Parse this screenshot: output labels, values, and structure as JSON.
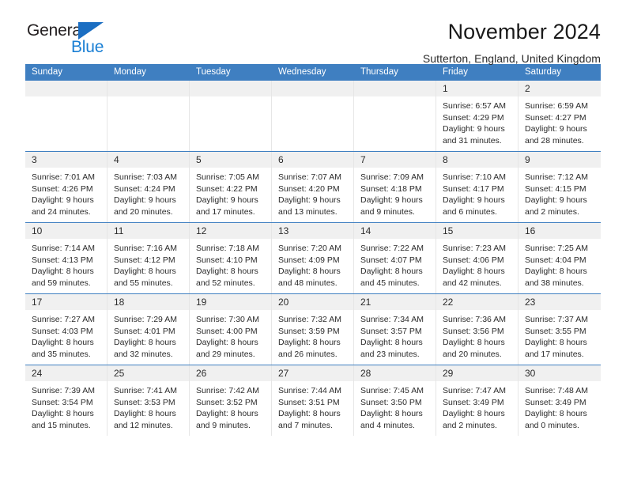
{
  "brand": {
    "name_part1": "General",
    "name_part2": "Blue",
    "triangle_icon": "triangle-icon",
    "accent_color": "#1b6ec2",
    "blue_text_color": "#1a7fd4"
  },
  "header": {
    "title": "November 2024",
    "subtitle": "Sutterton, England, United Kingdom"
  },
  "colors": {
    "header_blue": "#3f7fc1",
    "cell_head_gray": "#f0f0f0",
    "text": "#2b2b2b"
  },
  "weekdays": [
    "Sunday",
    "Monday",
    "Tuesday",
    "Wednesday",
    "Thursday",
    "Friday",
    "Saturday"
  ],
  "labels": {
    "sunrise_prefix": "Sunrise:",
    "sunset_prefix": "Sunset:",
    "daylight_prefix": "Daylight:"
  },
  "weeks": [
    [
      {
        "day": "",
        "sunrise": "",
        "sunset": "",
        "daylight": "",
        "empty": true
      },
      {
        "day": "",
        "sunrise": "",
        "sunset": "",
        "daylight": "",
        "empty": true
      },
      {
        "day": "",
        "sunrise": "",
        "sunset": "",
        "daylight": "",
        "empty": true
      },
      {
        "day": "",
        "sunrise": "",
        "sunset": "",
        "daylight": "",
        "empty": true
      },
      {
        "day": "",
        "sunrise": "",
        "sunset": "",
        "daylight": "",
        "empty": true
      },
      {
        "day": "1",
        "sunrise": "Sunrise: 6:57 AM",
        "sunset": "Sunset: 4:29 PM",
        "daylight": "Daylight: 9 hours and 31 minutes.",
        "empty": false
      },
      {
        "day": "2",
        "sunrise": "Sunrise: 6:59 AM",
        "sunset": "Sunset: 4:27 PM",
        "daylight": "Daylight: 9 hours and 28 minutes.",
        "empty": false
      }
    ],
    [
      {
        "day": "3",
        "sunrise": "Sunrise: 7:01 AM",
        "sunset": "Sunset: 4:26 PM",
        "daylight": "Daylight: 9 hours and 24 minutes.",
        "empty": false
      },
      {
        "day": "4",
        "sunrise": "Sunrise: 7:03 AM",
        "sunset": "Sunset: 4:24 PM",
        "daylight": "Daylight: 9 hours and 20 minutes.",
        "empty": false
      },
      {
        "day": "5",
        "sunrise": "Sunrise: 7:05 AM",
        "sunset": "Sunset: 4:22 PM",
        "daylight": "Daylight: 9 hours and 17 minutes.",
        "empty": false
      },
      {
        "day": "6",
        "sunrise": "Sunrise: 7:07 AM",
        "sunset": "Sunset: 4:20 PM",
        "daylight": "Daylight: 9 hours and 13 minutes.",
        "empty": false
      },
      {
        "day": "7",
        "sunrise": "Sunrise: 7:09 AM",
        "sunset": "Sunset: 4:18 PM",
        "daylight": "Daylight: 9 hours and 9 minutes.",
        "empty": false
      },
      {
        "day": "8",
        "sunrise": "Sunrise: 7:10 AM",
        "sunset": "Sunset: 4:17 PM",
        "daylight": "Daylight: 9 hours and 6 minutes.",
        "empty": false
      },
      {
        "day": "9",
        "sunrise": "Sunrise: 7:12 AM",
        "sunset": "Sunset: 4:15 PM",
        "daylight": "Daylight: 9 hours and 2 minutes.",
        "empty": false
      }
    ],
    [
      {
        "day": "10",
        "sunrise": "Sunrise: 7:14 AM",
        "sunset": "Sunset: 4:13 PM",
        "daylight": "Daylight: 8 hours and 59 minutes.",
        "empty": false
      },
      {
        "day": "11",
        "sunrise": "Sunrise: 7:16 AM",
        "sunset": "Sunset: 4:12 PM",
        "daylight": "Daylight: 8 hours and 55 minutes.",
        "empty": false
      },
      {
        "day": "12",
        "sunrise": "Sunrise: 7:18 AM",
        "sunset": "Sunset: 4:10 PM",
        "daylight": "Daylight: 8 hours and 52 minutes.",
        "empty": false
      },
      {
        "day": "13",
        "sunrise": "Sunrise: 7:20 AM",
        "sunset": "Sunset: 4:09 PM",
        "daylight": "Daylight: 8 hours and 48 minutes.",
        "empty": false
      },
      {
        "day": "14",
        "sunrise": "Sunrise: 7:22 AM",
        "sunset": "Sunset: 4:07 PM",
        "daylight": "Daylight: 8 hours and 45 minutes.",
        "empty": false
      },
      {
        "day": "15",
        "sunrise": "Sunrise: 7:23 AM",
        "sunset": "Sunset: 4:06 PM",
        "daylight": "Daylight: 8 hours and 42 minutes.",
        "empty": false
      },
      {
        "day": "16",
        "sunrise": "Sunrise: 7:25 AM",
        "sunset": "Sunset: 4:04 PM",
        "daylight": "Daylight: 8 hours and 38 minutes.",
        "empty": false
      }
    ],
    [
      {
        "day": "17",
        "sunrise": "Sunrise: 7:27 AM",
        "sunset": "Sunset: 4:03 PM",
        "daylight": "Daylight: 8 hours and 35 minutes.",
        "empty": false
      },
      {
        "day": "18",
        "sunrise": "Sunrise: 7:29 AM",
        "sunset": "Sunset: 4:01 PM",
        "daylight": "Daylight: 8 hours and 32 minutes.",
        "empty": false
      },
      {
        "day": "19",
        "sunrise": "Sunrise: 7:30 AM",
        "sunset": "Sunset: 4:00 PM",
        "daylight": "Daylight: 8 hours and 29 minutes.",
        "empty": false
      },
      {
        "day": "20",
        "sunrise": "Sunrise: 7:32 AM",
        "sunset": "Sunset: 3:59 PM",
        "daylight": "Daylight: 8 hours and 26 minutes.",
        "empty": false
      },
      {
        "day": "21",
        "sunrise": "Sunrise: 7:34 AM",
        "sunset": "Sunset: 3:57 PM",
        "daylight": "Daylight: 8 hours and 23 minutes.",
        "empty": false
      },
      {
        "day": "22",
        "sunrise": "Sunrise: 7:36 AM",
        "sunset": "Sunset: 3:56 PM",
        "daylight": "Daylight: 8 hours and 20 minutes.",
        "empty": false
      },
      {
        "day": "23",
        "sunrise": "Sunrise: 7:37 AM",
        "sunset": "Sunset: 3:55 PM",
        "daylight": "Daylight: 8 hours and 17 minutes.",
        "empty": false
      }
    ],
    [
      {
        "day": "24",
        "sunrise": "Sunrise: 7:39 AM",
        "sunset": "Sunset: 3:54 PM",
        "daylight": "Daylight: 8 hours and 15 minutes.",
        "empty": false
      },
      {
        "day": "25",
        "sunrise": "Sunrise: 7:41 AM",
        "sunset": "Sunset: 3:53 PM",
        "daylight": "Daylight: 8 hours and 12 minutes.",
        "empty": false
      },
      {
        "day": "26",
        "sunrise": "Sunrise: 7:42 AM",
        "sunset": "Sunset: 3:52 PM",
        "daylight": "Daylight: 8 hours and 9 minutes.",
        "empty": false
      },
      {
        "day": "27",
        "sunrise": "Sunrise: 7:44 AM",
        "sunset": "Sunset: 3:51 PM",
        "daylight": "Daylight: 8 hours and 7 minutes.",
        "empty": false
      },
      {
        "day": "28",
        "sunrise": "Sunrise: 7:45 AM",
        "sunset": "Sunset: 3:50 PM",
        "daylight": "Daylight: 8 hours and 4 minutes.",
        "empty": false
      },
      {
        "day": "29",
        "sunrise": "Sunrise: 7:47 AM",
        "sunset": "Sunset: 3:49 PM",
        "daylight": "Daylight: 8 hours and 2 minutes.",
        "empty": false
      },
      {
        "day": "30",
        "sunrise": "Sunrise: 7:48 AM",
        "sunset": "Sunset: 3:49 PM",
        "daylight": "Daylight: 8 hours and 0 minutes.",
        "empty": false
      }
    ]
  ]
}
